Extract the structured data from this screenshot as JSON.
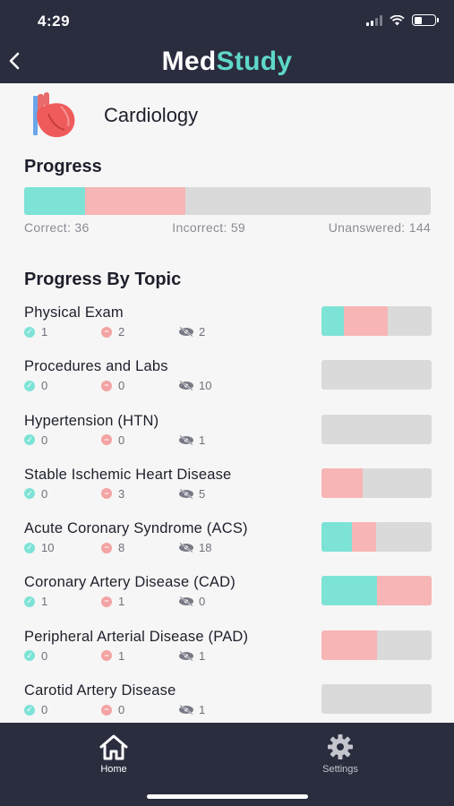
{
  "status_bar": {
    "time": "4:29"
  },
  "header": {
    "logo_med": "Med",
    "logo_study": "Study",
    "back_icon": "chevron-left-icon"
  },
  "subject": {
    "title": "Cardiology",
    "icon": "heart-icon"
  },
  "progress": {
    "heading": "Progress",
    "correct_label": "Correct: 36",
    "incorrect_label": "Incorrect: 59",
    "unanswered_label": "Unanswered: 144",
    "correct": 36,
    "incorrect": 59,
    "unanswered": 144
  },
  "topics_heading": "Progress By Topic",
  "topics": [
    {
      "name": "Physical Exam",
      "correct": "1",
      "incorrect": "2",
      "unanswered": "2",
      "c": 1,
      "i": 2,
      "u": 2
    },
    {
      "name": "Procedures and Labs",
      "correct": "0",
      "incorrect": "0",
      "unanswered": "10",
      "c": 0,
      "i": 0,
      "u": 10
    },
    {
      "name": "Hypertension (HTN)",
      "correct": "0",
      "incorrect": "0",
      "unanswered": "1",
      "c": 0,
      "i": 0,
      "u": 1
    },
    {
      "name": "Stable Ischemic Heart Disease",
      "correct": "0",
      "incorrect": "3",
      "unanswered": "5",
      "c": 0,
      "i": 3,
      "u": 5
    },
    {
      "name": "Acute Coronary Syndrome (ACS)",
      "correct": "10",
      "incorrect": "8",
      "unanswered": "18",
      "c": 10,
      "i": 8,
      "u": 18
    },
    {
      "name": "Coronary Artery Disease (CAD)",
      "correct": "1",
      "incorrect": "1",
      "unanswered": "0",
      "c": 1,
      "i": 1,
      "u": 0
    },
    {
      "name": "Peripheral Arterial Disease (PAD)",
      "correct": "0",
      "incorrect": "1",
      "unanswered": "1",
      "c": 0,
      "i": 1,
      "u": 1
    },
    {
      "name": "Carotid Artery Disease",
      "correct": "0",
      "incorrect": "0",
      "unanswered": "1",
      "c": 0,
      "i": 0,
      "u": 1
    }
  ],
  "tabbar": {
    "home_label": "Home",
    "settings_label": "Settings",
    "home_icon": "home-icon",
    "settings_icon": "gear-icon"
  },
  "colors": {
    "header_bg": "#2a2d3e",
    "correct": "#7de3d6",
    "incorrect": "#f7b5b5",
    "unanswered": "#dadada",
    "accent": "#5fd8c9"
  }
}
